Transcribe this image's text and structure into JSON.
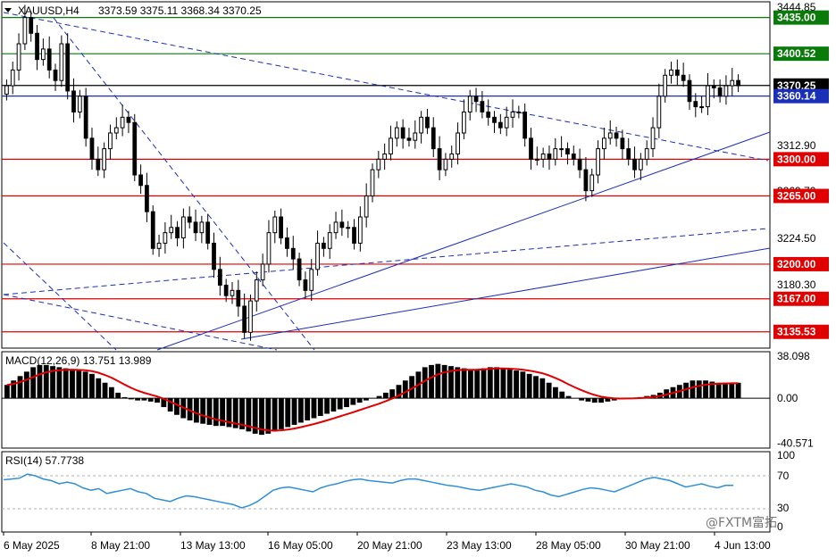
{
  "header": {
    "symbol": "XAUUSD,H4",
    "ohlc": "3373.59 3375.11 3368.34 3370.25"
  },
  "colors": {
    "grid": "#c0c0c0",
    "candle": "#000000",
    "trendline": "#1a2fb8",
    "resistance": "#e00000",
    "tag_green": "#0a7a0a",
    "tag_red": "#e00000",
    "tag_blue": "#1a2fb8",
    "macd_signal": "#e00000",
    "rsi_line": "#2f8fd6"
  },
  "watermark": "@FXTM富拓",
  "chart_data": [
    {
      "type": "candlestick",
      "title": "XAUUSD,H4",
      "ylim": [
        3120,
        3450
      ],
      "y_ticks": [
        "3444.85",
        "3400.52",
        "3370.25",
        "3360.14",
        "3312.90",
        "3269.70",
        "3224.50",
        "3180.30",
        "3135.53"
      ],
      "x_labels": [
        "6 May 2025",
        "8 May 21:00",
        "13 May 13:00",
        "16 May 05:00",
        "20 May 21:00",
        "23 May 13:00",
        "28 May 05:00",
        "30 May 21:00",
        "4 Jun 13:00"
      ],
      "levels": [
        {
          "label": "3435.00",
          "value": 3435.0,
          "color": "green"
        },
        {
          "label": "3400.52",
          "value": 3400.52,
          "color": "green"
        },
        {
          "label": "3370.25",
          "value": 3370.25,
          "color": "black"
        },
        {
          "label": "3360.14",
          "value": 3360.14,
          "color": "blue"
        },
        {
          "label": "3300.00",
          "value": 3300.0,
          "color": "red"
        },
        {
          "label": "3265.00",
          "value": 3265.0,
          "color": "red"
        },
        {
          "label": "3200.00",
          "value": 3200.0,
          "color": "red"
        },
        {
          "label": "3167.00",
          "value": 3167.0,
          "color": "red"
        },
        {
          "label": "3135.53",
          "value": 3135.53,
          "color": "red"
        }
      ],
      "closes": [
        3370,
        3385,
        3410,
        3435,
        3420,
        3395,
        3405,
        3385,
        3375,
        3410,
        3365,
        3345,
        3360,
        3320,
        3300,
        3290,
        3310,
        3325,
        3330,
        3340,
        3335,
        3285,
        3275,
        3250,
        3215,
        3220,
        3230,
        3235,
        3225,
        3245,
        3240,
        3230,
        3240,
        3220,
        3195,
        3180,
        3170,
        3175,
        3160,
        3135,
        3165,
        3185,
        3200,
        3230,
        3245,
        3225,
        3215,
        3205,
        3185,
        3175,
        3195,
        3220,
        3215,
        3230,
        3240,
        3235,
        3235,
        3220,
        3245,
        3265,
        3290,
        3300,
        3305,
        3320,
        3330,
        3320,
        3318,
        3325,
        3340,
        3330,
        3310,
        3290,
        3300,
        3305,
        3325,
        3345,
        3360,
        3355,
        3345,
        3340,
        3335,
        3330,
        3340,
        3345,
        3345,
        3320,
        3300,
        3300,
        3305,
        3300,
        3310,
        3310,
        3305,
        3300,
        3290,
        3270,
        3285,
        3310,
        3320,
        3325,
        3320,
        3310,
        3300,
        3290,
        3300,
        3310,
        3330,
        3360,
        3380,
        3385,
        3380,
        3375,
        3355,
        3350,
        3350,
        3370,
        3368,
        3360,
        3370,
        3375,
        3370
      ]
    },
    {
      "type": "bar",
      "title": "MACD(12,26,9) 13.751 13.989",
      "y_ticks": [
        "38.098",
        "0.00",
        "-40.571"
      ],
      "ylim": [
        -45,
        42
      ],
      "histogram": [
        12,
        16,
        20,
        24,
        28,
        30,
        30,
        29,
        28,
        27,
        26,
        25,
        24,
        22,
        18,
        14,
        10,
        5,
        1,
        -1,
        -2,
        -2,
        -3,
        -4,
        -8,
        -12,
        -15,
        -18,
        -20,
        -22,
        -23,
        -24,
        -25,
        -25,
        -26,
        -27,
        -28,
        -30,
        -32,
        -33,
        -32,
        -30,
        -28,
        -26,
        -24,
        -22,
        -20,
        -18,
        -16,
        -14,
        -12,
        -10,
        -8,
        -6,
        -4,
        -2,
        0,
        2,
        5,
        8,
        12,
        16,
        20,
        24,
        28,
        30,
        31,
        30,
        29,
        28,
        27,
        26,
        26,
        27,
        28,
        28,
        27,
        26,
        25,
        24,
        22,
        20,
        18,
        14,
        10,
        6,
        2,
        0,
        -2,
        -3,
        -4,
        -4,
        -3,
        -2,
        -1,
        0,
        0,
        1,
        2,
        3,
        5,
        8,
        10,
        12,
        14,
        16,
        16,
        16,
        15,
        14,
        14,
        14,
        14
      ]
    },
    {
      "type": "line",
      "title": "RSI(14) 57.7738",
      "y_ticks": [
        "100",
        "70",
        "30",
        "0"
      ],
      "ylim": [
        0,
        100
      ],
      "rsi": [
        65,
        66,
        67,
        72,
        70,
        66,
        64,
        60,
        62,
        60,
        55,
        52,
        54,
        48,
        50,
        52,
        54,
        50,
        48,
        42,
        40,
        38,
        42,
        45,
        44,
        42,
        40,
        38,
        36,
        34,
        30,
        33,
        38,
        45,
        52,
        55,
        56,
        54,
        52,
        50,
        55,
        58,
        60,
        63,
        65,
        66,
        64,
        63,
        62,
        61,
        64,
        66,
        66,
        64,
        62,
        60,
        58,
        57,
        55,
        53,
        52,
        54,
        56,
        58,
        60,
        58,
        56,
        52,
        50,
        46,
        44,
        47,
        50,
        53,
        55,
        54,
        52,
        50,
        54,
        58,
        62,
        66,
        68,
        66,
        64,
        60,
        56,
        58,
        60,
        57,
        55,
        58,
        58
      ]
    }
  ]
}
